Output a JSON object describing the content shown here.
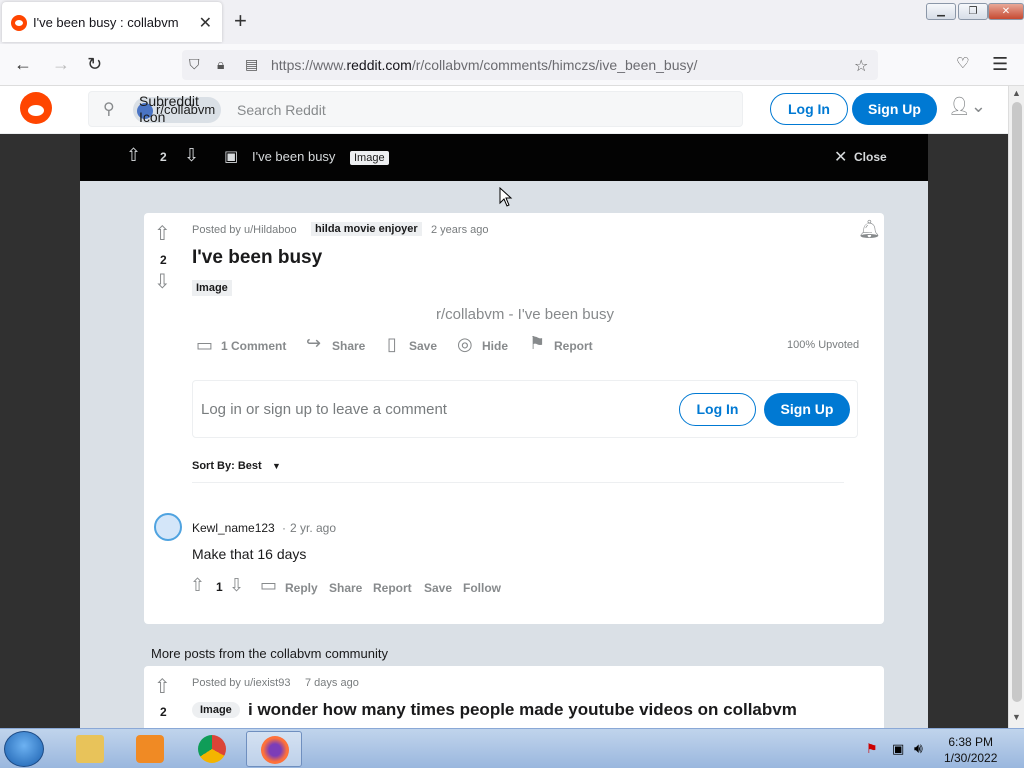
{
  "browser": {
    "tab_title": "I've been busy : collabvm",
    "url_prefix": "https://www.",
    "url_domain": "reddit.com",
    "url_path": "/r/collabvm/comments/himczs/ive_been_busy/"
  },
  "header": {
    "subreddit_chip": "r/collabvm",
    "subreddit_icon_alt": "Subreddit Icon",
    "search_placeholder": "Search Reddit",
    "login_label": "Log In",
    "signup_label": "Sign Up"
  },
  "topbar": {
    "vote_count": "2",
    "title": "I've been busy",
    "flair": "Image",
    "close_label": "Close"
  },
  "post": {
    "posted_by": "Posted by u/Hildaboo",
    "user_flair": "hilda movie enjoyer",
    "age": "2 years ago",
    "votes": "2",
    "title": "I've been busy",
    "flair": "Image",
    "image_alt": "r/collabvm - I've been busy",
    "actions": {
      "comments": "1 Comment",
      "share": "Share",
      "save": "Save",
      "hide": "Hide",
      "report": "Report"
    },
    "upvoted": "100% Upvoted",
    "comment_prompt": "Log in or sign up to leave a comment",
    "login_label": "Log In",
    "signup_label": "Sign Up",
    "sort_label": "Sort By: Best"
  },
  "comment": {
    "author": "Kewl_name123",
    "age": "2 yr. ago",
    "text": "Make that 16 days",
    "votes": "1",
    "reply": "Reply",
    "share": "Share",
    "report": "Report",
    "save": "Save",
    "follow": "Follow"
  },
  "more": {
    "heading": "More posts from the collabvm community",
    "posted_by": "Posted by u/iexist93",
    "age": "7 days ago",
    "votes": "2",
    "flair": "Image",
    "title": "i wonder how many times people made youtube videos on collabvm"
  },
  "taskbar": {
    "time": "6:38 PM",
    "date": "1/30/2022"
  },
  "colors": {
    "reddit_orange": "#ff4500",
    "reddit_blue": "#0079d3",
    "dark_bar": "#030303"
  }
}
